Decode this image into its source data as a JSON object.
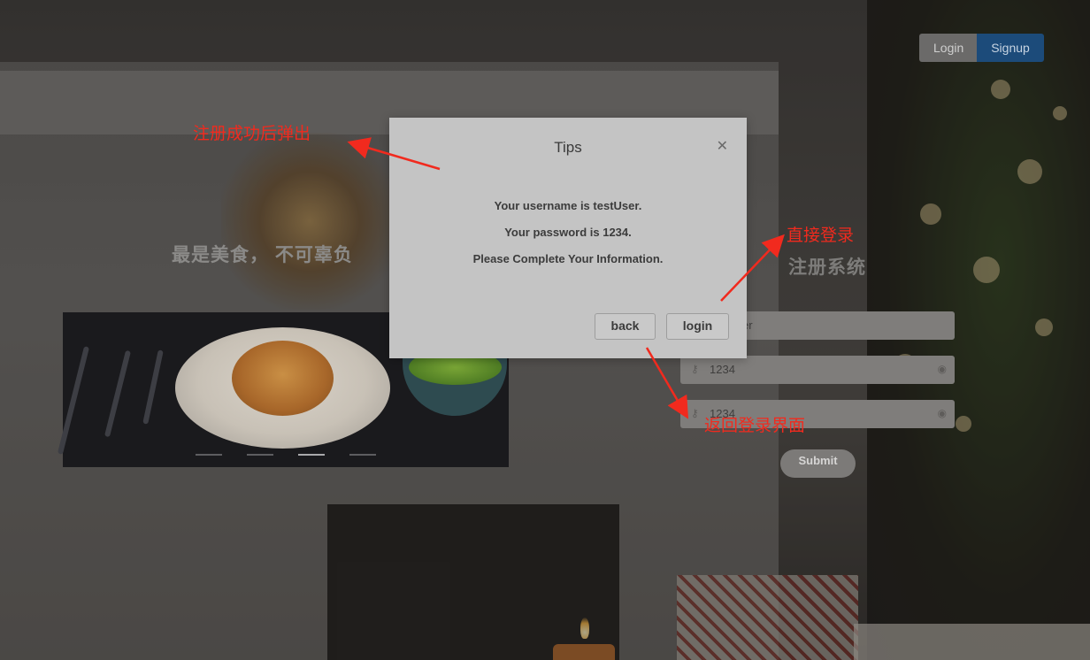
{
  "header": {
    "login_label": "Login",
    "signup_label": "Signup"
  },
  "left": {
    "slogan": "最是美食， 不可辜负"
  },
  "carousel": {
    "indicator_count": 4,
    "active_index": 2
  },
  "register": {
    "title": "注册系统",
    "username_value": "er",
    "password_value": "1234",
    "confirm_value": "1234",
    "submit_label": "Submit"
  },
  "modal": {
    "title": "Tips",
    "line1": "Your username is testUser.",
    "line2": "Your password is 1234.",
    "line3": "Please Complete Your Information.",
    "back_label": "back",
    "login_label": "login"
  },
  "annotations": {
    "popup_note": "注册成功后弹出",
    "direct_login_note": "直接登录",
    "back_note": "返回登录界面",
    "color": "#f12a1e"
  }
}
